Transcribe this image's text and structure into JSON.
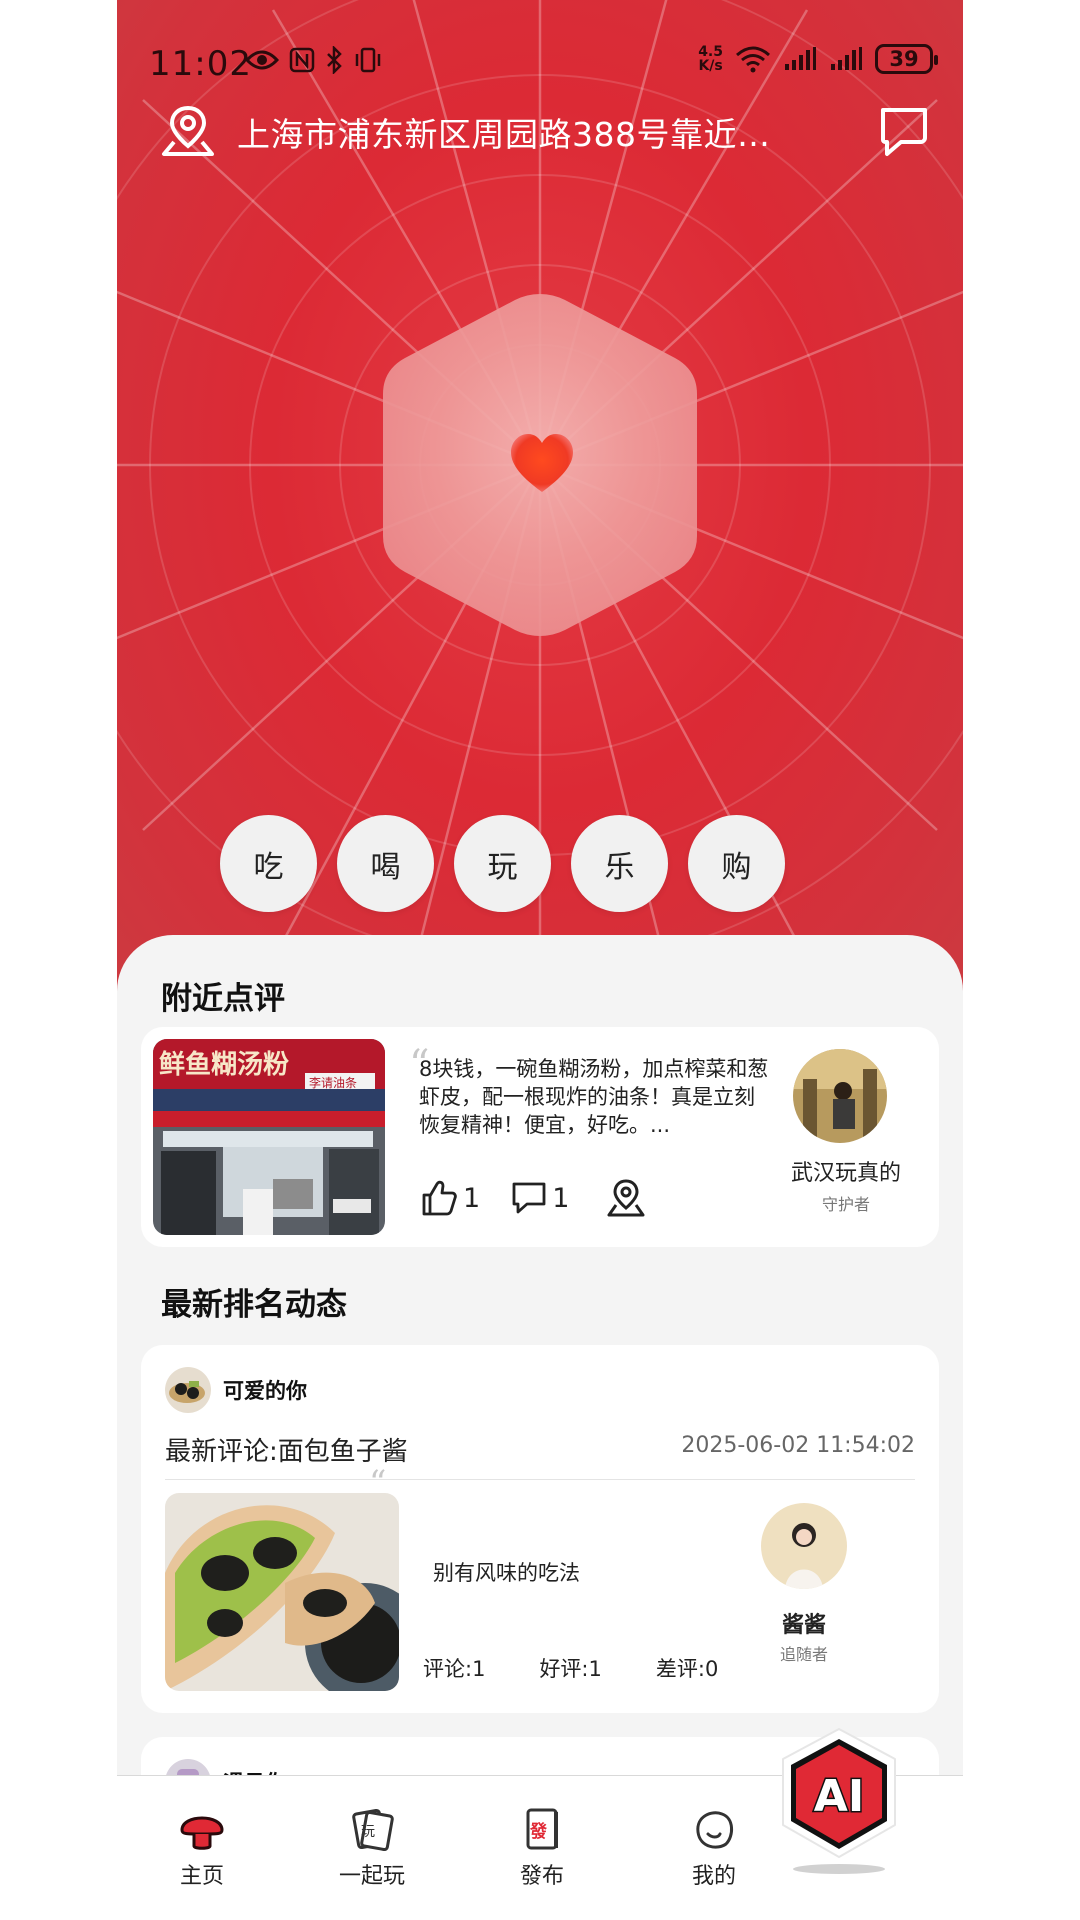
{
  "status_bar": {
    "time": "11:02",
    "net_speed_value": "4.5",
    "net_speed_unit": "K/s",
    "battery": "39"
  },
  "location": {
    "address": "上海市浦东新区周园路388号靠近…"
  },
  "categories": [
    "吃",
    "喝",
    "玩",
    "乐",
    "购"
  ],
  "nearby": {
    "title": "附近点评",
    "review": {
      "text": "8块钱，一碗鱼糊汤粉，加点榨菜和葱虾皮，配一根现炸的油条！真是立刻恢复精神！便宜，好吃。...",
      "likes": "1",
      "comments": "1",
      "user_name": "武汉玩真的",
      "user_role": "守护者",
      "shop_sign": "鲜鱼糊汤粉",
      "shop_sub": "李请油条"
    }
  },
  "ranking": {
    "title": "最新排名动态",
    "item": {
      "author": "可爱的你",
      "comment_label": "最新评论:面包鱼子酱",
      "date": "2025-06-02 11:54:02",
      "text": "别有风味的吃法",
      "stats": [
        "评论:1",
        "好评:1",
        "差评:0"
      ],
      "user_name": "酱酱",
      "user_role": "追随者"
    },
    "next_author": "遇见你"
  },
  "bottom_nav": [
    {
      "label": "主页",
      "icon": "mushroom-home-icon"
    },
    {
      "label": "一起玩",
      "icon": "cards-play-icon"
    },
    {
      "label": "發布",
      "icon": "mahjong-publish-icon"
    },
    {
      "label": "我的",
      "icon": "profile-blob-icon"
    }
  ],
  "ai_button": {
    "label": "AI"
  },
  "colors": {
    "brand_red": "#dc2a35",
    "dark_text": "#111111"
  }
}
